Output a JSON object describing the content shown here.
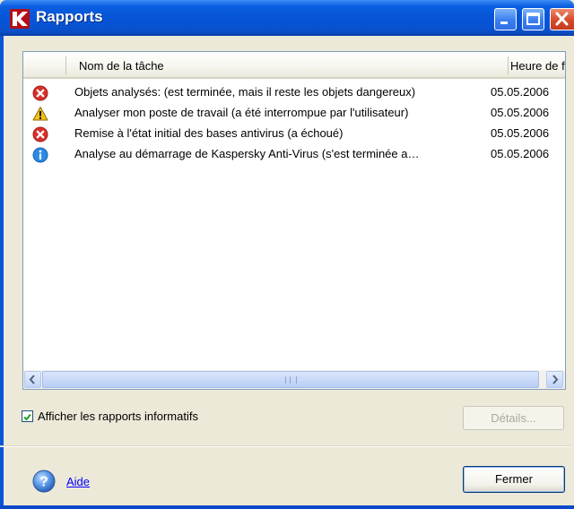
{
  "window": {
    "title": "Rapports",
    "app_icon": "kaspersky-k-icon",
    "titlebar_buttons": [
      "minimize-icon",
      "maximize-icon",
      "close-icon"
    ]
  },
  "table": {
    "columns": [
      "Nom de la tâche",
      "Heure de fi"
    ],
    "rows": [
      {
        "icon": "error-icon",
        "name": "Objets analysés: (est terminée, mais il reste les objets dangereux)",
        "date": "05.05.2006"
      },
      {
        "icon": "warning-icon",
        "name": "Analyser mon poste de travail (a été interrompue par l'utilisateur)",
        "date": "05.05.2006"
      },
      {
        "icon": "error-icon",
        "name": "Remise à l'état initial des bases antivirus (a échoué)",
        "date": "05.05.2006"
      },
      {
        "icon": "info-icon",
        "name": "Analyse au démarrage de Kaspersky Anti-Virus (s'est terminée a…",
        "date": "05.05.2006"
      }
    ]
  },
  "options": {
    "show_info_reports_label": "Afficher les rapports informatifs",
    "show_info_reports_checked": true
  },
  "buttons": {
    "details": "Détails...",
    "details_enabled": false,
    "close": "Fermer"
  },
  "help": {
    "label": "Aide",
    "icon": "help-icon"
  },
  "colors": {
    "titlebar": "#0a5ee0",
    "dialog_bg": "#ece9d8",
    "error": "#d6302b",
    "warning": "#f2c21a",
    "info": "#2a8be0",
    "link": "#0000ff"
  }
}
